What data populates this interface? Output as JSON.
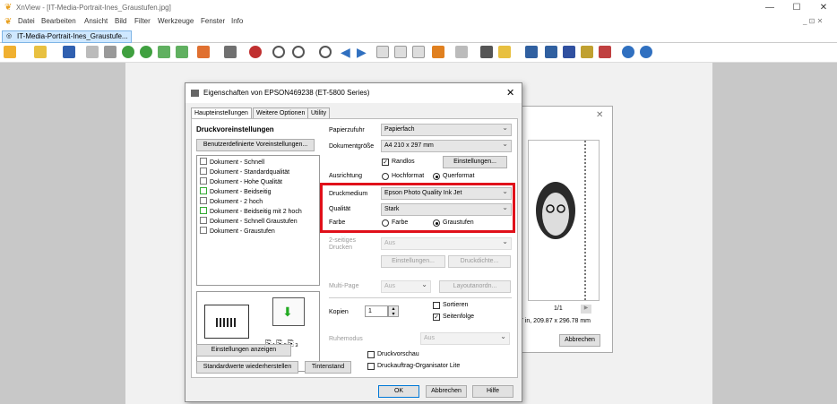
{
  "app": {
    "title": "XnView - [IT-Media-Portrait-Ines_Graustufen.jpg]",
    "tab": "IT-Media-Portrait-Ines_Graustufe...",
    "window_controls": [
      "—",
      "☐",
      "✕"
    ],
    "mdi_controls": "_ ⊡ ✕"
  },
  "menu": [
    "Datei",
    "Bearbeiten",
    "Ansicht",
    "Bild",
    "Filter",
    "Werkzeuge",
    "Fenster",
    "Info"
  ],
  "background_dialog": {
    "page": "1/1",
    "size": "7 in, 209.87 x 296.78 mm",
    "cancel": "Abbrechen"
  },
  "dialog": {
    "title": "Eigenschaften von EPSON469238 (ET-5800 Series)",
    "tabs": [
      "Haupteinstellungen",
      "Weitere Optionen",
      "Utility"
    ],
    "presets": {
      "heading": "Druckvoreinstellungen",
      "button": "Benutzerdefinierte Voreinstellungen...",
      "items": [
        "Dokument - Schnell",
        "Dokument - Standardqualität",
        "Dokument - Hohe Qualität",
        "Dokument - Beidseitig",
        "Dokument - 2 hoch",
        "Dokument - Beidseitig mit 2 hoch",
        "Dokument - Schnell Graustufen",
        "Dokument - Graustufen"
      ]
    },
    "papierzufuhr": {
      "label": "Papierzufuhr",
      "value": "Papierfach"
    },
    "dokumentgroesse": {
      "label": "Dokumentgröße",
      "value": "A4 210 x 297 mm"
    },
    "randlos": {
      "label": "Randlos",
      "checked": true
    },
    "einstellungen1": "Einstellungen...",
    "ausrichtung": {
      "label": "Ausrichtung",
      "hoch": "Hochformat",
      "quer": "Querformat"
    },
    "druckmedium": {
      "label": "Druckmedium",
      "value": "Epson Photo Quality Ink Jet"
    },
    "qualitaet": {
      "label": "Qualität",
      "value": "Stark"
    },
    "farbe": {
      "label": "Farbe",
      "farbe": "Farbe",
      "grau": "Graustufen"
    },
    "zweiseitig": {
      "label": "2-seitiges Drucken",
      "value": "Aus",
      "einstellungen": "Einstellungen...",
      "druckdichte": "Druckdichte..."
    },
    "multipage": {
      "label": "Multi-Page",
      "value": "Aus",
      "layout": "Layoutanordn..."
    },
    "kopien": {
      "label": "Kopien",
      "value": "1"
    },
    "sortieren": "Sortieren",
    "seitenfolge": "Seitenfolge",
    "ruhemodus": {
      "label": "Ruhemodus",
      "value": "Aus"
    },
    "einstellungen_anzeigen": "Einstellungen anzeigen",
    "standardwerte": "Standardwerte wiederherstellen",
    "tintenstand": "Tintenstand",
    "druckvorschau": "Druckvorschau",
    "organisator": "Druckauftrag-Organisator Lite",
    "ok": "OK",
    "abbrechen": "Abbrechen",
    "hilfe": "Hilfe"
  },
  "colors": {
    "highlight": "#e0101a",
    "tab": "#cfe8ff"
  }
}
